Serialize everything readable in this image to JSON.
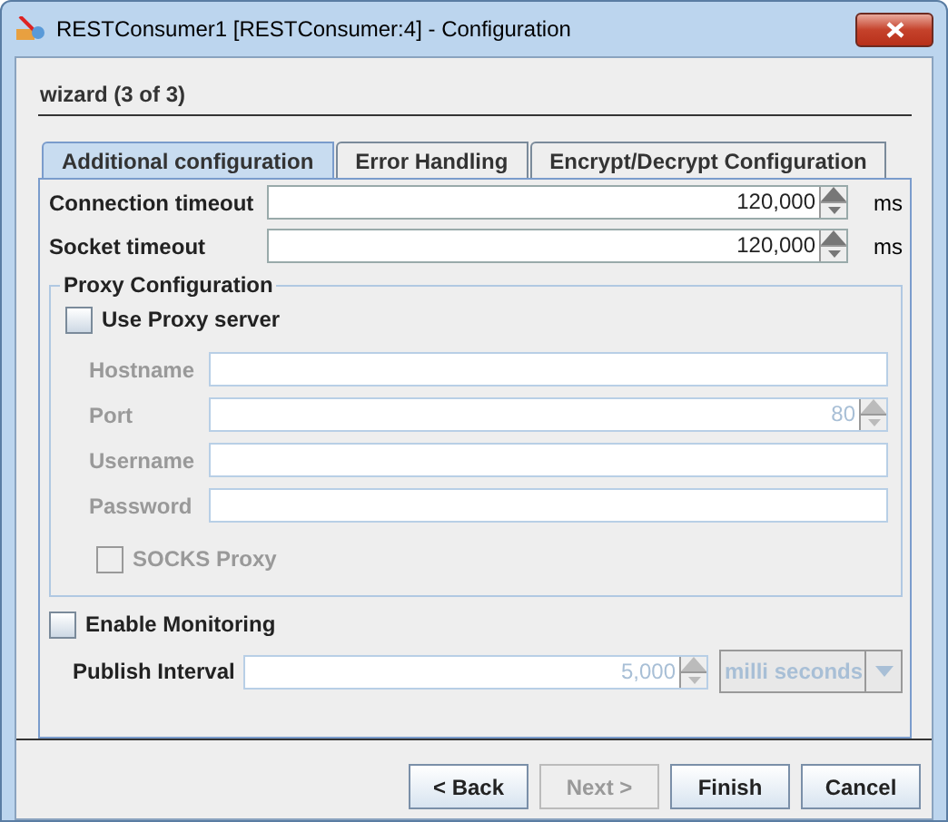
{
  "window": {
    "title": "RESTConsumer1 [RESTConsumer:4] - Configuration"
  },
  "wizard_title": "wizard (3 of 3)",
  "tabs": [
    {
      "label": "Additional configuration",
      "selected": true
    },
    {
      "label": "Error Handling",
      "selected": false
    },
    {
      "label": "Encrypt/Decrypt Configuration",
      "selected": false
    }
  ],
  "timeouts": [
    {
      "label": "Connection timeout",
      "value": "120,000",
      "unit": "ms"
    },
    {
      "label": "Socket timeout",
      "value": "120,000",
      "unit": "ms"
    }
  ],
  "proxy": {
    "title": "Proxy Configuration",
    "use_proxy": {
      "label": "Use Proxy server",
      "checked": false
    },
    "fields": [
      {
        "kind": "text",
        "label": "Hostname",
        "disabled": true
      },
      {
        "kind": "spinner",
        "label": "Port",
        "value": "80",
        "disabled": true
      },
      {
        "kind": "text",
        "label": "Username",
        "disabled": true
      },
      {
        "kind": "text",
        "label": "Password",
        "disabled": true
      }
    ],
    "socks": {
      "label": "SOCKS Proxy",
      "checked": false,
      "disabled": true
    }
  },
  "monitoring": {
    "label": "Enable Monitoring",
    "checked": false
  },
  "publish": {
    "label": "Publish Interval",
    "value": "5,000",
    "unit": "milli seconds",
    "disabled": true
  },
  "buttons": [
    {
      "label": "< Back",
      "disabled": false
    },
    {
      "label": "Next >",
      "disabled": true
    },
    {
      "label": "Finish",
      "disabled": false
    },
    {
      "label": "Cancel",
      "disabled": false
    }
  ]
}
